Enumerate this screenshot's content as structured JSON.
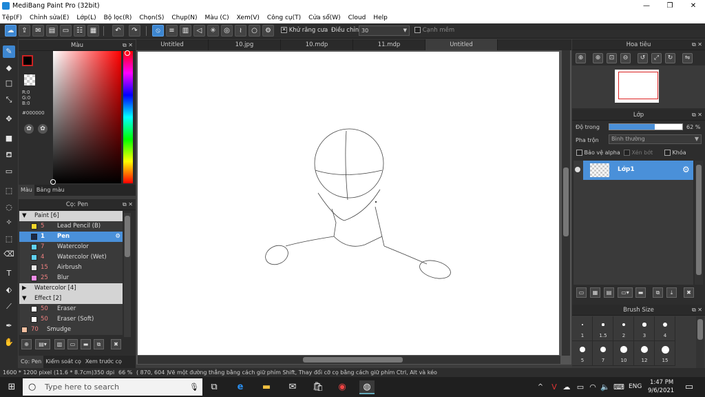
{
  "window": {
    "title": "MediBang Paint Pro (32bit)",
    "minimize": "—",
    "restore": "❐",
    "close": "✕"
  },
  "menu": [
    "Tệp(F)",
    "Chỉnh sửa(E)",
    "Lớp(L)",
    "Bộ lọc(R)",
    "Chọn(S)",
    "Chụp(N)",
    "Màu (C)",
    "Xem(V)",
    "Công cụ(T)",
    "Cửa sổ(W)",
    "Cloud",
    "Help"
  ],
  "toolbar": {
    "antialias_label": "Khử răng cưa",
    "adjust_label": "Điều chỉnh",
    "adjust_value": "30",
    "edge_label": "Cạnh mềm"
  },
  "color_panel": {
    "title": "Màu",
    "r": "R:0",
    "g": "G:0",
    "b": "B:0",
    "hex": "#000000",
    "tabs": [
      "Màu",
      "Bảng màu"
    ]
  },
  "brush_panel": {
    "title": "Cọ: Pen",
    "rows": [
      {
        "type": "group",
        "expander": "▼",
        "label": "Paint [6]"
      },
      {
        "type": "item",
        "swatch": "#f2d62b",
        "size": "5",
        "name": "Lead Pencil (B)"
      },
      {
        "type": "sel",
        "swatch": "#1a2a4a",
        "size": "1",
        "name": "Pen"
      },
      {
        "type": "item",
        "swatch": "#5fd0f0",
        "size": "7",
        "name": "Watercolor"
      },
      {
        "type": "item",
        "swatch": "#5fd0f0",
        "size": "4",
        "name": "Watercolor (Wet)"
      },
      {
        "type": "item",
        "swatch": "#e8e8e8",
        "size": "15",
        "name": "Airbrush"
      },
      {
        "type": "item",
        "swatch": "#f08ce8",
        "size": "25",
        "name": "Blur"
      },
      {
        "type": "group",
        "expander": "▶",
        "label": "Watercolor [4]"
      },
      {
        "type": "group",
        "expander": "▼",
        "label": "Effect [2]"
      },
      {
        "type": "item",
        "swatch": "#ffffff",
        "size": "50",
        "name": "Eraser"
      },
      {
        "type": "item",
        "swatch": "#ffffff",
        "size": "50",
        "name": "Eraser (Soft)"
      },
      {
        "type": "item2",
        "swatch": "#f5c0a0",
        "size": "70",
        "name": "Smudge"
      }
    ],
    "tabs": [
      "Cọ: Pen",
      "Kiểm soát cọ",
      "Xem trước cọ"
    ]
  },
  "doc_tabs": [
    "Untitled",
    "10.jpg",
    "10.mdp",
    "11.mdp",
    "Untitled"
  ],
  "navigator": {
    "title": "Hoa tiêu"
  },
  "layer_panel": {
    "title": "Lớp",
    "opacity_label": "Độ trong",
    "opacity_value": 62,
    "opacity_text": "62 %",
    "blend_label": "Pha trộn",
    "blend_value": "Bình thường",
    "protect_alpha": "Bảo vệ alpha",
    "clipping": "Xén bớt",
    "lock": "Khóa",
    "layer_name": "Lớp1"
  },
  "brush_size": {
    "title": "Brush Size",
    "sizes": [
      "1",
      "1.5",
      "2",
      "3",
      "4",
      "5",
      "7",
      "10",
      "12",
      "15"
    ]
  },
  "status": {
    "dims": "1600 * 1200 pixel",
    "cm": "(11.6 * 8.7cm)",
    "dpi": "350 dpi",
    "zoom": "66 %",
    "coords": "( 870, 604 )",
    "hint": "Vẽ một đường thẳng bằng cách giữ phím Shift, Thay đổi cỡ cọ bằng cách giữ phím Ctrl, Alt và kéo"
  },
  "taskbar": {
    "search_placeholder": "Type here to search",
    "time": "1:47 PM",
    "date": "9/6/2021",
    "lang": "ENG"
  },
  "colors": {
    "accent": "#3d86d0",
    "panel": "#2d2d2d",
    "canvas": "#ffffff"
  }
}
